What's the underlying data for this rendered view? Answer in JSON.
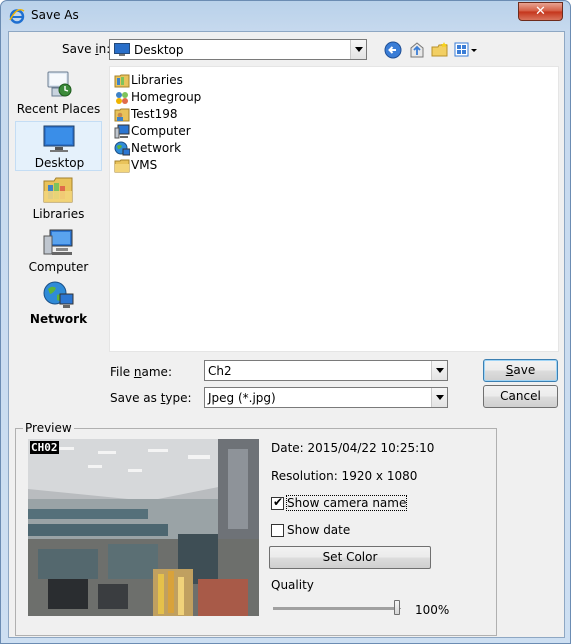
{
  "window": {
    "title": "Save As",
    "close_label": "✕"
  },
  "toolbar": {
    "save_in_label_pre": "Save ",
    "save_in_label_u": "i",
    "save_in_label_post": "n:",
    "save_in_value": "Desktop"
  },
  "places": [
    {
      "label": "Recent Places",
      "icon": "recent-places-icon"
    },
    {
      "label": "Desktop",
      "icon": "desktop-icon"
    },
    {
      "label": "Libraries",
      "icon": "libraries-icon"
    },
    {
      "label": "Computer",
      "icon": "computer-icon"
    },
    {
      "label": "Network",
      "icon": "network-icon"
    }
  ],
  "files": [
    {
      "name": "Libraries",
      "icon": "libraries-icon"
    },
    {
      "name": "Homegroup",
      "icon": "homegroup-icon"
    },
    {
      "name": "Test198",
      "icon": "user-folder-icon"
    },
    {
      "name": "Computer",
      "icon": "computer-icon"
    },
    {
      "name": "Network",
      "icon": "network-icon"
    },
    {
      "name": "VMS",
      "icon": "folder-icon"
    }
  ],
  "form": {
    "file_name_pre": "File ",
    "file_name_u": "n",
    "file_name_post": "ame:",
    "file_name_value": "Ch2",
    "save_type_pre": "Save as ",
    "save_type_u": "t",
    "save_type_post": "ype:",
    "save_type_value": "Jpeg (*.jpg)",
    "save_u": "S",
    "save_rest": "ave",
    "cancel": "Cancel"
  },
  "preview": {
    "title": "Preview",
    "camera_label": "CH02",
    "date": "Date: 2015/04/22 10:25:10",
    "resolution": "Resolution: 1920 x 1080",
    "show_camera_name": "Show camera name",
    "show_camera_name_checked": true,
    "show_date": "Show date",
    "show_date_checked": false,
    "set_color": "Set Color",
    "quality_label": "Quality",
    "quality_value": 100,
    "quality_text": "100%"
  },
  "colors": {
    "title_bar": "#c6d9ee",
    "dialog_bg": "#f0f0f0",
    "selected_place": "#e5f1fb",
    "close_button": "#c4331a"
  }
}
